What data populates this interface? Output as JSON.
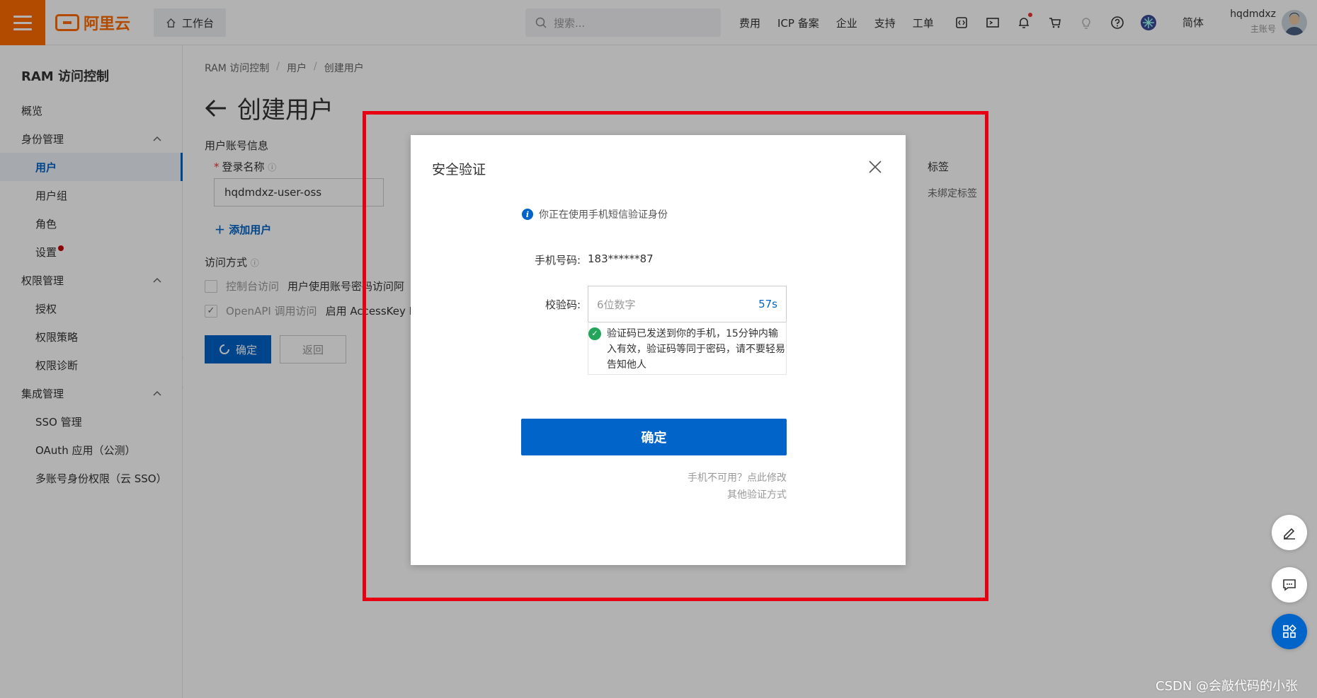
{
  "topbar": {
    "brand": "阿里云",
    "workbench": "工作台",
    "search_placeholder": "搜索...",
    "links": [
      "费用",
      "ICP 备案",
      "企业",
      "支持",
      "工单"
    ],
    "icons": [
      "code-icon",
      "terminal-icon",
      "bell-icon",
      "cart-icon",
      "bulb-icon",
      "help-icon",
      "star-avatar-icon"
    ],
    "language": "简体",
    "username": "hqdmdxz",
    "account_type": "主账号",
    "accent_color": "#ff6a00"
  },
  "sidebar": {
    "title": "RAM 访问控制",
    "items": [
      {
        "label": "概览",
        "kind": "group"
      },
      {
        "label": "身份管理",
        "kind": "group",
        "expanded": true
      },
      {
        "label": "用户",
        "kind": "child",
        "active": true
      },
      {
        "label": "用户组",
        "kind": "child"
      },
      {
        "label": "角色",
        "kind": "child"
      },
      {
        "label": "设置",
        "kind": "child",
        "badge_dot": true
      },
      {
        "label": "权限管理",
        "kind": "group",
        "expanded": true
      },
      {
        "label": "授权",
        "kind": "child"
      },
      {
        "label": "权限策略",
        "kind": "child"
      },
      {
        "label": "权限诊断",
        "kind": "child"
      },
      {
        "label": "集成管理",
        "kind": "group",
        "expanded": true
      },
      {
        "label": "SSO 管理",
        "kind": "child"
      },
      {
        "label": "OAuth 应用（公测）",
        "kind": "child"
      },
      {
        "label": "多账号身份权限（云 SSO）",
        "kind": "child"
      }
    ]
  },
  "main": {
    "breadcrumb": [
      "RAM 访问控制",
      "用户",
      "创建用户"
    ],
    "title": "创建用户",
    "section_account": "用户账号信息",
    "login_name_label": "登录名称",
    "login_name_value": "hqdmdxz-user-oss",
    "tag_label": "标签",
    "tag_value": "未绑定标签",
    "add_user": "添加用户",
    "access_label": "访问方式",
    "access_options": [
      {
        "label": "控制台访问",
        "desc": "用户使用账号密码访问阿",
        "checked": false
      },
      {
        "label": "OpenAPI 调用访问",
        "desc": "启用 AccessKey ID",
        "checked": true
      }
    ],
    "confirm": "确定",
    "back": "返回"
  },
  "modal": {
    "title": "安全验证",
    "info": "你正在使用手机短信验证身份",
    "phone_label": "手机号码:",
    "phone_value": "183******87",
    "code_label": "校验码:",
    "code_placeholder": "6位数字",
    "countdown": "57s",
    "sent_message": "验证码已发送到你的手机，15分钟内输入有效，验证码等同于密码，请不要轻易告知他人",
    "confirm": "确定",
    "phone_unavailable": "手机不可用？点此修改",
    "other_methods": "其他验证方式",
    "primary_color": "#0064c8"
  },
  "watermark": "CSDN @会敲代码的小张"
}
